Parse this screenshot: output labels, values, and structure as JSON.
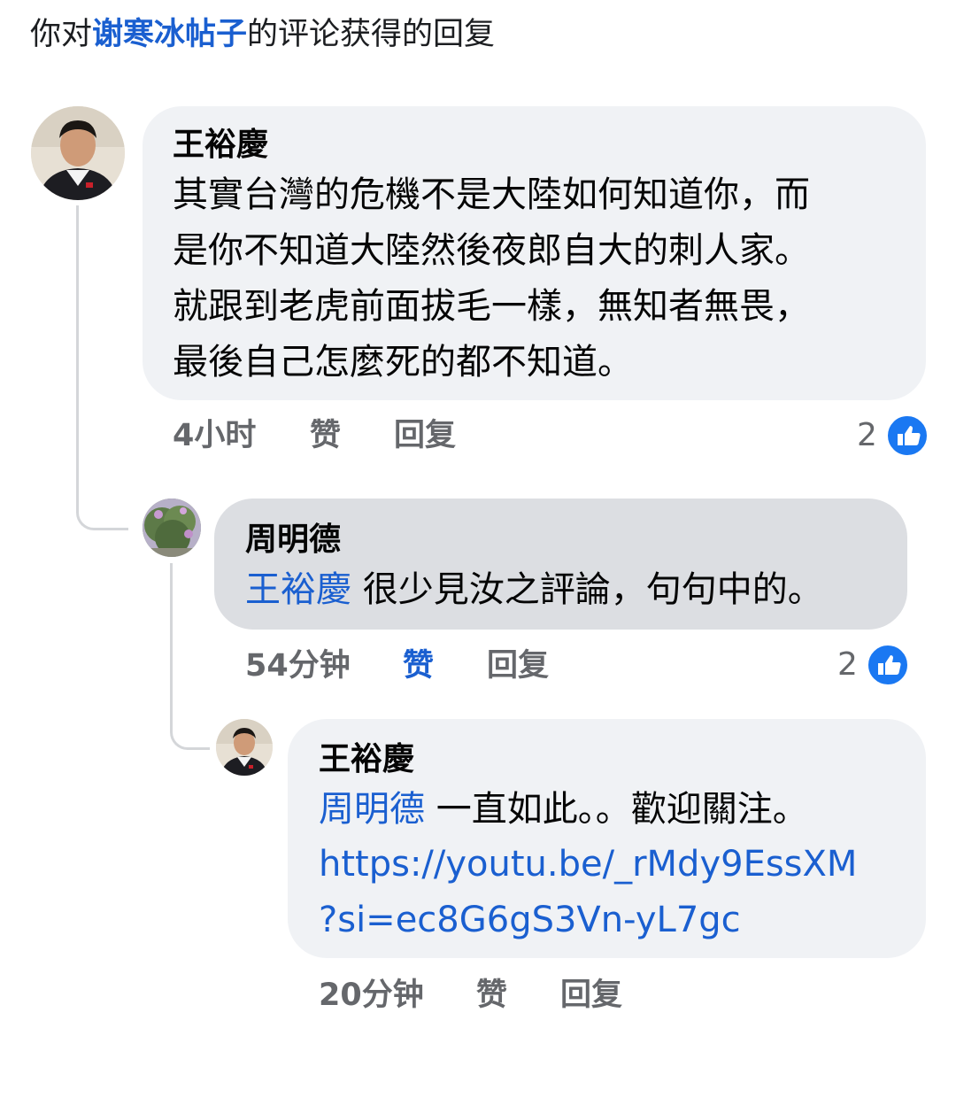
{
  "header": {
    "prefix": "你对",
    "post_owner": "谢寒冰帖子",
    "suffix": "的评论获得的回复"
  },
  "comments": [
    {
      "author": "王裕慶",
      "lines": [
        "其實台灣的危機不是大陸如何知道你，而",
        "是你不知道大陸然後夜郎自大的刺人家。",
        "就跟到老虎前面拔毛一樣，無知者無畏，",
        "最後自己怎麼死的都不知道。"
      ],
      "time": "4小时",
      "like_label": "赞",
      "reply_label": "回复",
      "reaction_count": "2",
      "liked": false,
      "reaction_icon": "thumbs-up-icon"
    },
    {
      "author": "周明德",
      "mention": "王裕慶",
      "text": " 很少見汝之評論，句句中的。",
      "time": "54分钟",
      "like_label": "赞",
      "reply_label": "回复",
      "reaction_count": "2",
      "liked": true,
      "reaction_icon": "thumbs-up-icon"
    },
    {
      "author": "王裕慶",
      "mention": "周明德",
      "text": " 一直如此。。歡迎關注。",
      "link_lines": [
        "https://youtu.be/_rMdy9EssXM",
        "?si=ec8G6gS3Vn-yL7gc"
      ],
      "time": "20分钟",
      "like_label": "赞",
      "reply_label": "回复",
      "liked": false
    }
  ],
  "colors": {
    "link": "#1a5fd0",
    "like_icon": "#1a78f2",
    "bubble": "#f0f2f5",
    "bubble_highlight": "#dcdee2",
    "meta": "#65676b"
  }
}
